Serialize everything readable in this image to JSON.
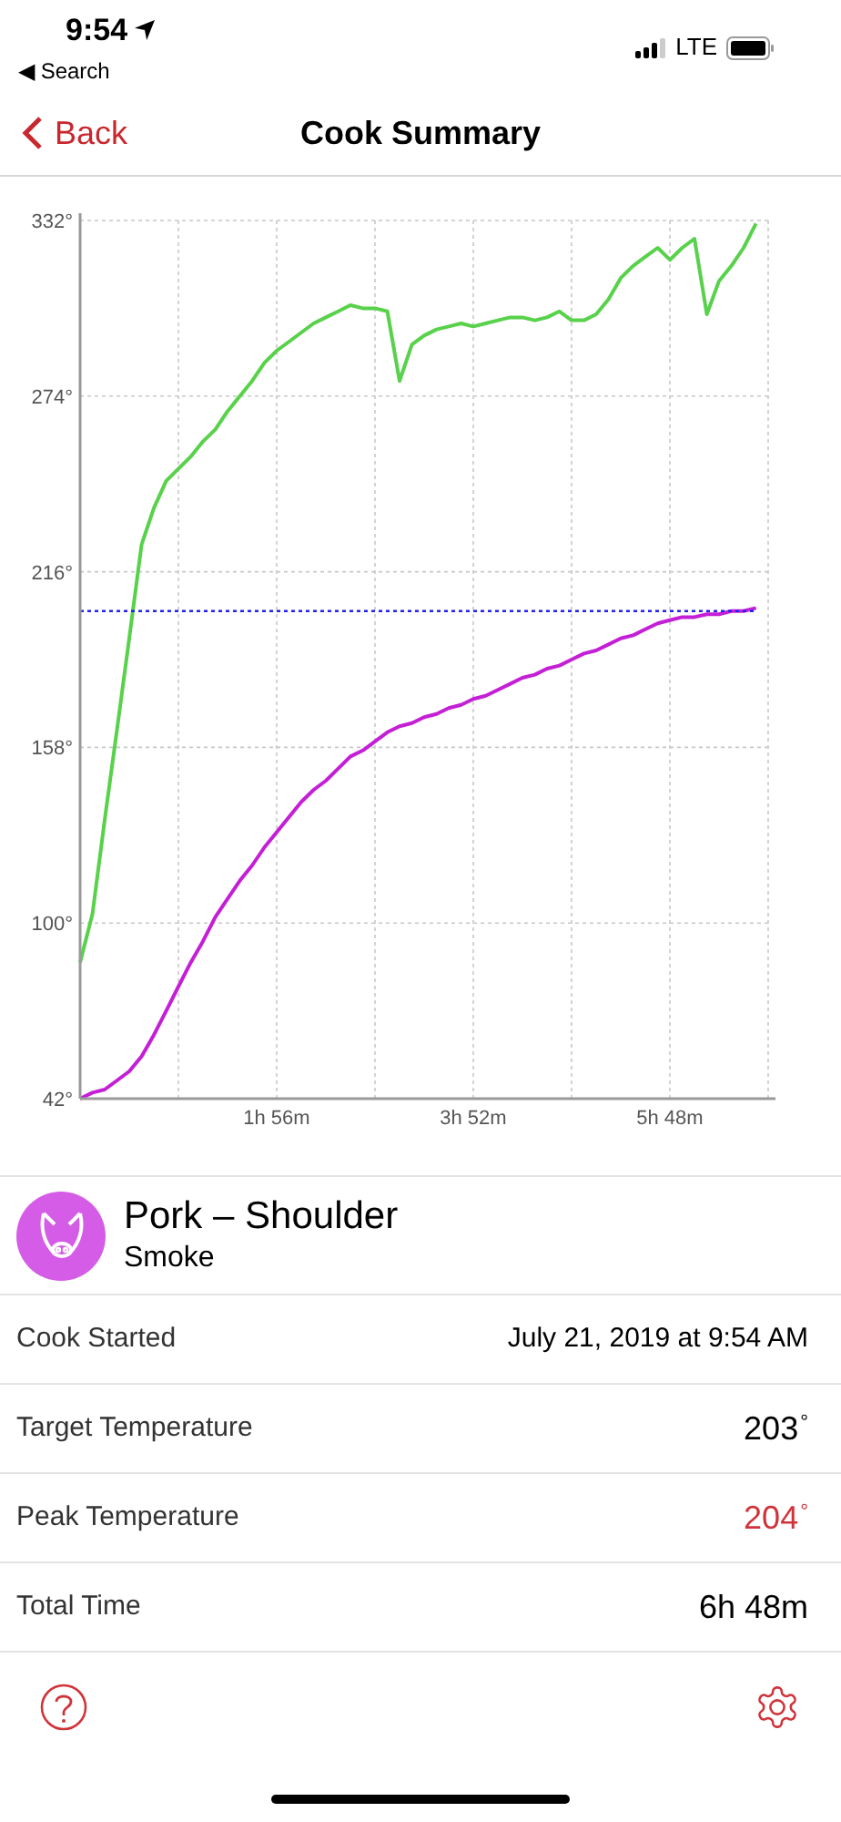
{
  "status_bar": {
    "time": "9:54",
    "back_app": "◀ Search",
    "network": "LTE"
  },
  "nav": {
    "back": "Back",
    "title": "Cook Summary"
  },
  "chart": {
    "chart_data": {
      "type": "line",
      "categories": [
        null,
        null,
        null,
        null,
        null,
        null,
        null,
        null,
        null,
        null,
        null,
        null,
        null,
        null,
        null,
        null,
        "1h 56m",
        null,
        null,
        null,
        null,
        null,
        null,
        null,
        null,
        null,
        null,
        null,
        null,
        null,
        null,
        null,
        "3h 52m",
        null,
        null,
        null,
        null,
        null,
        null,
        null,
        null,
        null,
        null,
        null,
        null,
        null,
        null,
        null,
        "5h 48m",
        null,
        null,
        null,
        null,
        null,
        null,
        null,
        null
      ],
      "series": [
        {
          "color": "#58d14b",
          "line_style": "solid",
          "values": [
            87,
            103,
            134,
            164,
            194,
            225,
            237,
            246,
            250,
            254,
            259,
            263,
            269,
            274,
            279,
            285,
            289,
            292,
            295,
            298,
            300,
            302,
            304,
            303,
            303,
            302,
            279,
            291,
            294,
            296,
            297,
            298,
            297,
            298,
            299,
            300,
            300,
            299,
            300,
            302,
            299,
            299,
            301,
            306,
            313,
            317,
            320,
            323,
            319,
            323,
            326,
            301,
            312,
            317,
            323,
            331,
            null
          ]
        },
        {
          "color": "#c41fd6",
          "line_style": "solid",
          "values": [
            42,
            44,
            45,
            48,
            51,
            56,
            63,
            71,
            79,
            87,
            94,
            102,
            108,
            114,
            119,
            125,
            130,
            135,
            140,
            144,
            147,
            151,
            155,
            157,
            160,
            163,
            165,
            166,
            168,
            169,
            171,
            172,
            174,
            175,
            177,
            179,
            181,
            182,
            184,
            185,
            187,
            189,
            190,
            192,
            194,
            195,
            197,
            199,
            200,
            201,
            201,
            202,
            202,
            203,
            203,
            204,
            null
          ]
        },
        {
          "color": "#2222ee",
          "line_style": "dotted",
          "values": [
            203,
            203,
            203,
            203,
            203,
            203,
            203,
            203,
            203,
            203,
            203,
            203,
            203,
            203,
            203,
            203,
            203,
            203,
            203,
            203,
            203,
            203,
            203,
            203,
            203,
            203,
            203,
            203,
            203,
            203,
            203,
            203,
            203,
            203,
            203,
            203,
            203,
            203,
            203,
            203,
            203,
            203,
            203,
            203,
            203,
            203,
            203,
            203,
            203,
            203,
            203,
            203,
            203,
            203,
            203,
            203,
            null
          ]
        }
      ],
      "grid": true,
      "ylim": [
        42,
        332
      ],
      "yticks": [
        {
          "value": 42,
          "label": "42°"
        },
        {
          "value": 100,
          "label": "100°"
        },
        {
          "value": 158,
          "label": "158°"
        },
        {
          "value": 216,
          "label": "216°"
        },
        {
          "value": 274,
          "label": "274°"
        },
        {
          "value": 332,
          "label": "332°"
        }
      ]
    }
  },
  "cook": {
    "name": "Pork – Shoulder",
    "method": "Smoke"
  },
  "details": [
    {
      "label": "Cook Started",
      "value": "July 21, 2019 at 9:54 AM",
      "kind": "text",
      "highlight": false
    },
    {
      "label": "Target Temperature",
      "value": "203",
      "kind": "temp",
      "highlight": false
    },
    {
      "label": "Peak Temperature",
      "value": "204",
      "kind": "temp",
      "highlight": true
    },
    {
      "label": "Total Time",
      "value": "6h 48m",
      "kind": "large",
      "highlight": false
    }
  ],
  "degree_sign": "°"
}
